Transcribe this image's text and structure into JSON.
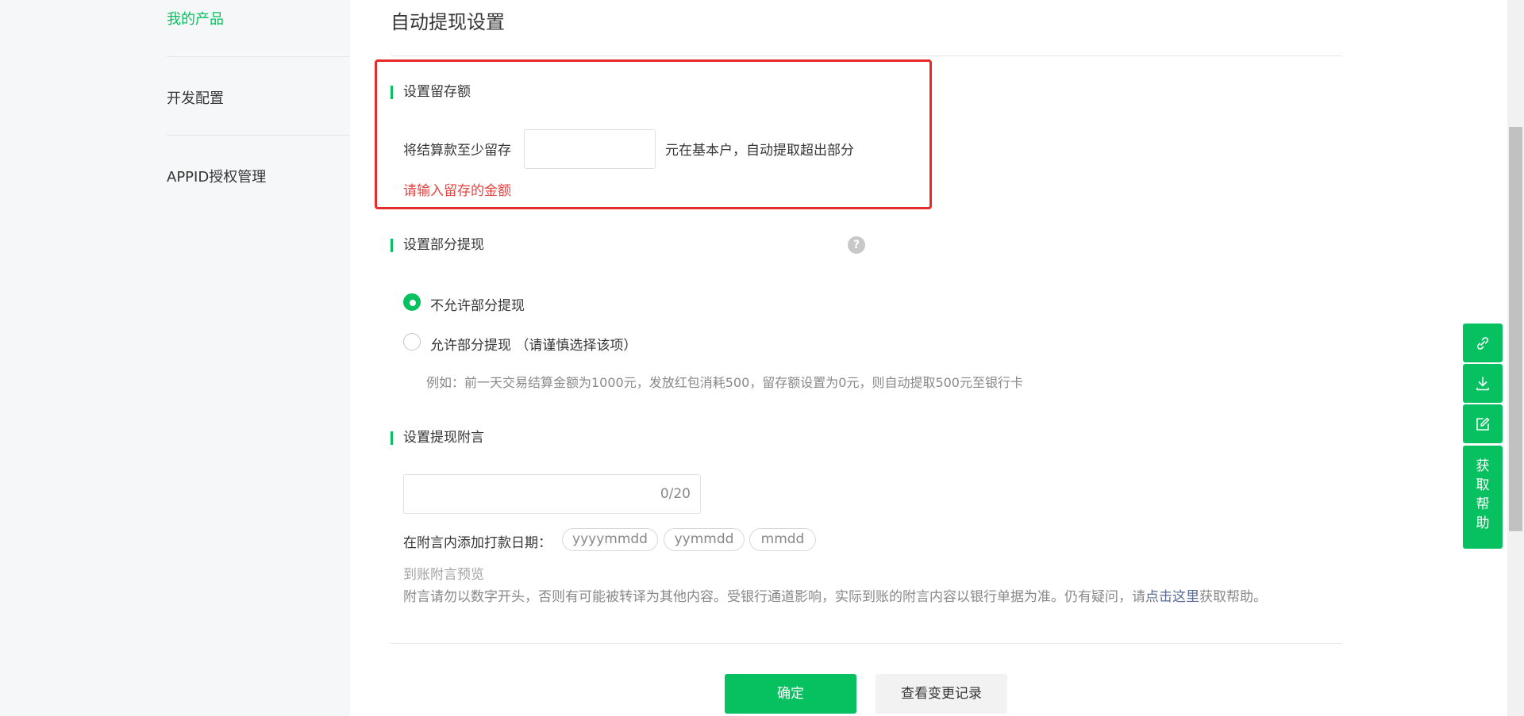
{
  "sidebar": {
    "items": [
      {
        "label": "我的产品"
      },
      {
        "label": "开发配置"
      },
      {
        "label": "APPID授权管理"
      }
    ]
  },
  "page": {
    "title": "自动提现设置"
  },
  "reserve": {
    "section_title": "设置留存额",
    "prefix": "将结算款至少留存",
    "input_value": "",
    "suffix": "元在基本户，自动提取超出部分",
    "error": "请输入留存的金额"
  },
  "partial": {
    "section_title": "设置部分提现",
    "help_icon": "?",
    "option_disallow": "不允许部分提现",
    "option_allow": "允许部分提现 （请谨慎选择该项）",
    "selected": "不允许部分提现",
    "example": "例如：前一天交易结算金额为1000元，发放红包消耗500，留存额设置为0元，则自动提取500元至银行卡"
  },
  "remark": {
    "section_title": "设置提现附言",
    "input_value": "",
    "counter": "0/20",
    "date_label": "在附言内添加打款日期：",
    "date_formats": [
      "yyyymmdd",
      "yymmdd",
      "mmdd"
    ],
    "preview_label": "到账附言预览",
    "note_prefix": "附言请勿以数字开头，否则有可能被转译为其他内容。受银行通道影响，实际到账的附言内容以银行单据为准。仍有疑问，请",
    "note_link": "点击这里",
    "note_suffix": "获取帮助。"
  },
  "actions": {
    "confirm": "确定",
    "history": "查看变更记录"
  },
  "float_toolbar": {
    "icons": [
      "link-icon",
      "download-icon",
      "edit-icon"
    ],
    "help_label": "获取帮助",
    "help_chars": [
      "获",
      "取",
      "帮",
      "助"
    ]
  },
  "colors": {
    "accent": "#07c160",
    "error": "#e64340",
    "highlight_border": "#e72b2b",
    "link": "#576b95"
  }
}
